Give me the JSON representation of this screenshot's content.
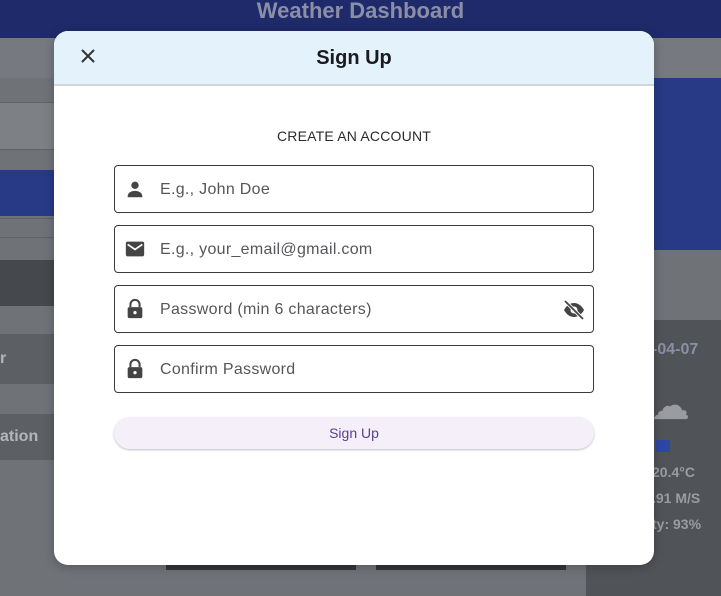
{
  "background": {
    "header_title": "Weather Dashboard",
    "left_button_1": "r",
    "left_button_2": "ation",
    "card_date": "-04-07",
    "card_temp": "20.4°C",
    "card_wind": ".91 M/S",
    "card_humidity": "ty: 93%"
  },
  "modal": {
    "title": "Sign Up",
    "subtitle": "CREATE AN ACCOUNT",
    "fields": {
      "name_placeholder": "E.g., John Doe",
      "email_placeholder": "E.g., your_email@gmail.com",
      "password_placeholder": "Password (min 6 characters)",
      "confirm_placeholder": "Confirm Password"
    },
    "submit_label": "Sign Up"
  },
  "icons": {
    "close": "close-icon",
    "person": "person-icon",
    "email": "email-icon",
    "lock": "lock-icon",
    "visibility_off": "visibility-off-icon",
    "cloud": "cloud-icon"
  },
  "colors": {
    "header_bg": "#1f2a6b",
    "modal_head_bg": "#e4f2fc",
    "button_bg": "#f4eff8",
    "button_text": "#5a3f8f"
  }
}
